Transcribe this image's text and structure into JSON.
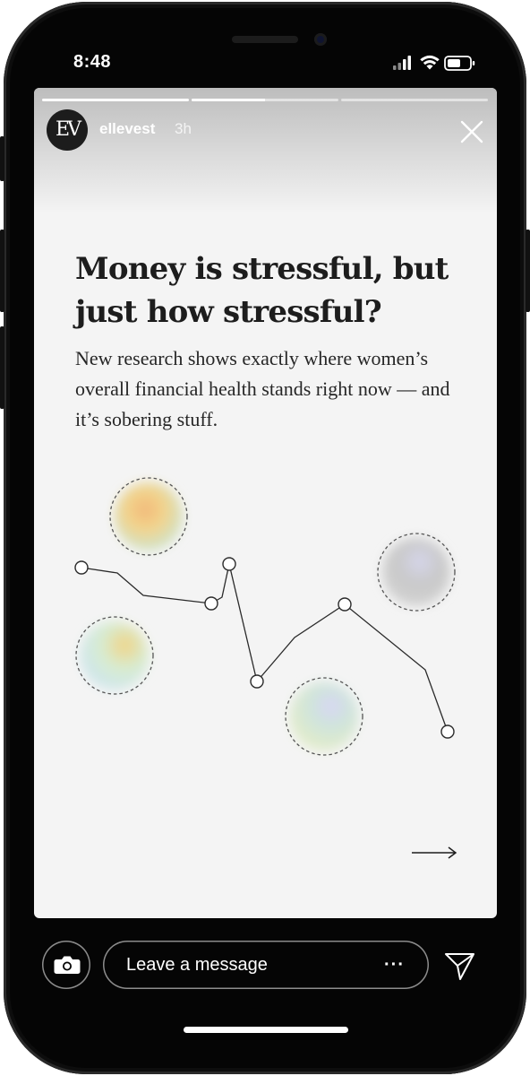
{
  "status_bar": {
    "time": "8:48"
  },
  "story": {
    "progress": [
      1,
      0.5,
      0
    ],
    "account_initials": "EV",
    "account_name": "ellevest",
    "posted_ago": "3h"
  },
  "content": {
    "headline": "Money is stressful, but just how stressful?",
    "subtext": "New research shows exactly where women’s overall financial health stands right now — and it’s sobering stuff."
  },
  "reply_bar": {
    "placeholder": "Leave a message",
    "more": "···"
  },
  "icons": {
    "close": "close-icon",
    "camera": "camera-icon",
    "send": "send-icon",
    "next": "arrow-right-icon"
  },
  "colors": {
    "story_background": "#f4f4f4",
    "phone_frame": "#050505",
    "ink": "#1d1d1d"
  }
}
